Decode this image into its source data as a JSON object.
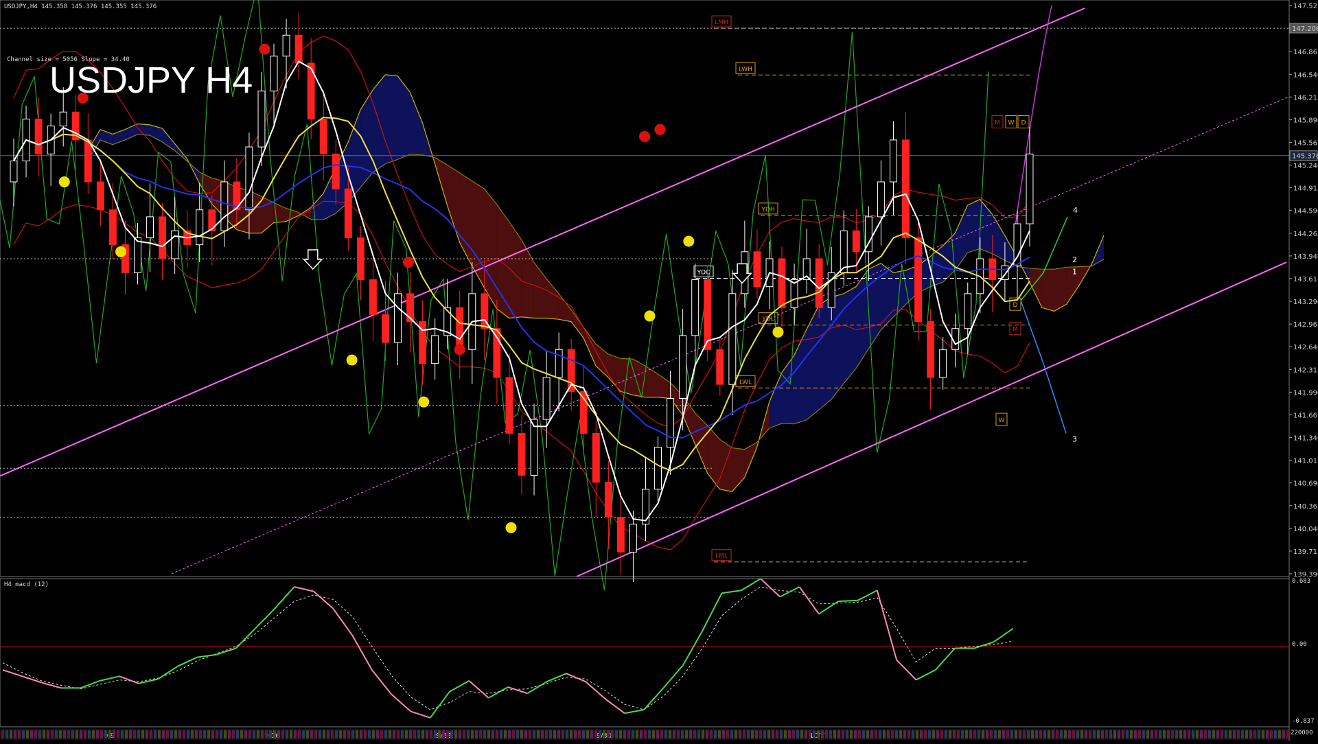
{
  "header": {
    "symbol_line": "USDJPY,H4  145.358 145.376 145.355 145.376",
    "channel_info": "Channel size = 5056  Slope = 34.40",
    "big_title": "USDJPY H4"
  },
  "macd_panel": {
    "label": "H4  macd (12)",
    "scale_top": "0.683",
    "scale_zero": "0.00",
    "scale_bottom": "-0.837",
    "bottom_label": "220000"
  },
  "price_axis": {
    "ticks": [
      "147.525",
      "147.200",
      "146.865",
      "146.540",
      "146.215",
      "145.890",
      "145.565",
      "145.240",
      "144.915",
      "144.590",
      "144.265",
      "143.940",
      "143.615",
      "143.290",
      "142.965",
      "142.640",
      "142.315",
      "141.990",
      "141.665",
      "141.340",
      "141.015",
      "140.690",
      "140.365",
      "140.040",
      "139.715",
      "139.390"
    ],
    "current_price": "145.376",
    "marked_level": "147.200"
  },
  "time_axis": {
    "labels": [
      "9/9",
      "9/16",
      "9/23",
      "9/30",
      "10/7"
    ]
  },
  "level_labels": {
    "lmh": "LMH",
    "lwh": "LWH",
    "ydh": "YDH",
    "ydc": "YDC",
    "ydl": "YDL",
    "lwl": "LWL",
    "lml": "LML",
    "m": "M",
    "w": "W",
    "d": "D",
    "d2": "D",
    "m2": "M",
    "w2": "W"
  },
  "wave_labels": [
    "4",
    "2",
    "1",
    "3"
  ],
  "colors": {
    "bull_candle": "#ffffff",
    "bear_candle": "#ff2020",
    "channel": "#ff66ff",
    "ma_white": "#ffffff",
    "ma_yellow": "#f0e040",
    "ma_blue": "#2233ee",
    "bollinger": "#cc1111",
    "ichimoku_span": "#c8b400",
    "macd_up": "#44dd44",
    "macd_down": "#ff88bb",
    "signal": "#dddddd",
    "zero_line": "#cc0000",
    "level_gold": "#e0a000",
    "level_red": "#cc2222"
  },
  "chart_data": {
    "type": "candlestick",
    "instrument": "USDJPY",
    "timeframe": "H4",
    "ylim": [
      139.39,
      147.525
    ],
    "last_price": 145.376,
    "levels": {
      "LMH": 147.2,
      "LWH": 146.53,
      "YDH": 144.52,
      "YDC": 143.62,
      "YDL": 142.95,
      "LWL": 142.05,
      "LML": 139.56
    },
    "close_path": [
      145.3,
      145.9,
      145.4,
      145.8,
      146.0,
      145.6,
      145.0,
      144.6,
      144.1,
      143.7,
      144.2,
      144.5,
      143.9,
      144.3,
      144.1,
      144.6,
      144.3,
      145.0,
      144.6,
      145.5,
      146.3,
      146.8,
      147.1,
      146.7,
      145.9,
      145.4,
      144.9,
      144.2,
      143.6,
      143.1,
      142.7,
      143.4,
      143.0,
      142.4,
      142.8,
      143.2,
      142.6,
      143.4,
      142.9,
      142.2,
      141.4,
      140.8,
      141.6,
      142.2,
      142.6,
      142.0,
      141.4,
      140.7,
      140.2,
      139.7,
      140.1,
      140.6,
      141.2,
      141.9,
      142.8,
      143.6,
      142.6,
      142.1,
      143.4,
      144.0,
      143.5,
      143.9,
      143.2,
      143.6,
      143.9,
      143.2,
      143.7,
      144.3,
      144.0,
      144.5,
      145.0,
      145.6,
      144.2,
      143.0,
      142.2,
      142.6,
      142.9,
      143.4,
      143.9,
      143.6,
      143.8,
      144.4,
      145.4
    ],
    "macd": [
      -0.26,
      -0.33,
      -0.4,
      -0.46,
      -0.46,
      -0.38,
      -0.33,
      -0.41,
      -0.36,
      -0.22,
      -0.12,
      -0.09,
      -0.02,
      0.2,
      0.42,
      0.66,
      0.61,
      0.42,
      0.12,
      -0.26,
      -0.53,
      -0.72,
      -0.79,
      -0.5,
      -0.38,
      -0.57,
      -0.45,
      -0.52,
      -0.39,
      -0.3,
      -0.39,
      -0.58,
      -0.74,
      -0.7,
      -0.46,
      -0.21,
      0.17,
      0.59,
      0.62,
      0.75,
      0.55,
      0.66,
      0.36,
      0.5,
      0.51,
      0.62,
      -0.15,
      -0.37,
      -0.26,
      -0.02,
      -0.02,
      0.05,
      0.2
    ],
    "signal": [
      -0.18,
      -0.29,
      -0.38,
      -0.43,
      -0.47,
      -0.42,
      -0.37,
      -0.39,
      -0.35,
      -0.27,
      -0.16,
      -0.08,
      0.0,
      0.14,
      0.32,
      0.5,
      0.57,
      0.52,
      0.33,
      0.0,
      -0.32,
      -0.56,
      -0.7,
      -0.62,
      -0.5,
      -0.52,
      -0.48,
      -0.47,
      -0.41,
      -0.34,
      -0.36,
      -0.49,
      -0.64,
      -0.7,
      -0.55,
      -0.33,
      -0.02,
      0.34,
      0.52,
      0.66,
      0.62,
      0.6,
      0.47,
      0.48,
      0.49,
      0.54,
      0.2,
      -0.17,
      -0.02,
      -0.02,
      0.0,
      0.02,
      0.06
    ]
  }
}
